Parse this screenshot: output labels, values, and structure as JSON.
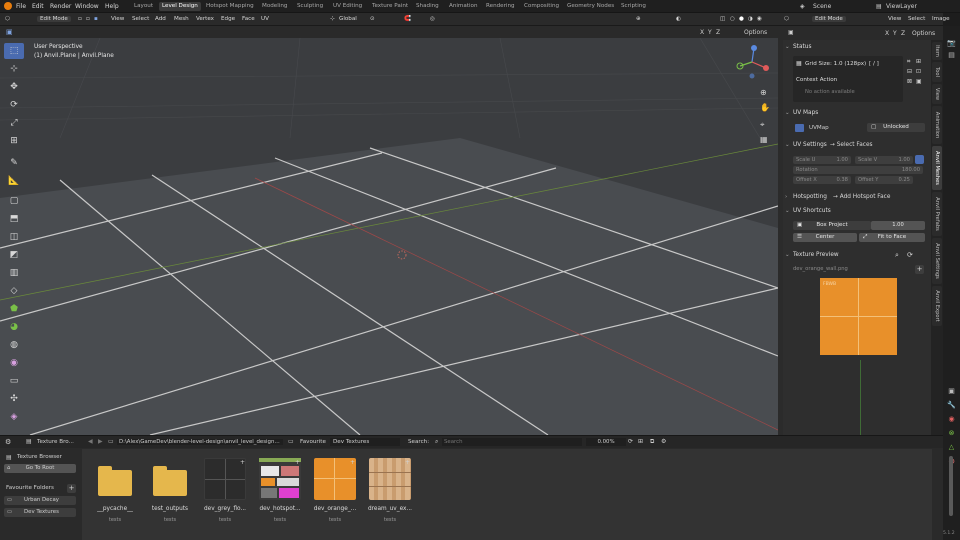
{
  "menu": [
    "File",
    "Edit",
    "Render",
    "Window",
    "Help"
  ],
  "workspaces": [
    "Layout",
    "Level Design",
    "Hotspot Mapping",
    "Modeling",
    "Sculpting",
    "UV Editing",
    "Texture Paint",
    "Shading",
    "Animation",
    "Rendering",
    "Compositing",
    "Geometry Nodes",
    "Scripting"
  ],
  "active_workspace": "Level Design",
  "scene": {
    "label": "Scene",
    "view_layer": "ViewLayer"
  },
  "viewport_header": {
    "mode": "Edit Mode",
    "menus": [
      "View",
      "Select",
      "Add",
      "Mesh",
      "Vertex",
      "Edge",
      "Face",
      "UV"
    ],
    "transform": "Global",
    "axes": [
      "X",
      "Y",
      "Z"
    ],
    "options": "Options"
  },
  "viewport": {
    "line1": "User Perspective",
    "line2": "(1) Anvil.Plane | Anvil.Plane"
  },
  "uv_header": {
    "mode": "Edit Mode",
    "menus": [
      "View",
      "Select",
      "Image"
    ],
    "axes": [
      "X",
      "Y",
      "Z"
    ],
    "options": "Options"
  },
  "npanel": {
    "status_title": "Status",
    "grid_size": "Grid Size: 1.0 (128px)",
    "grid_mark": "[ / ]",
    "context_action": "Context Action",
    "no_action": "No action available",
    "uv_maps_title": "UV Maps",
    "uvmap": "UVMap",
    "unlocked": "Unlocked",
    "uv_settings_title": "UV Settings",
    "uv_settings_sub": "→ Select Faces",
    "scale_u_label": "Scale U",
    "scale_u": "1.00",
    "scale_v_label": "Scale V",
    "scale_v": "1.00",
    "rotation_label": "Rotation",
    "rotation": "180.00",
    "offset_x_label": "Offset X",
    "offset_x": "0.38",
    "offset_y_label": "Offset Y",
    "offset_y": "0.25",
    "hotspotting_title": "Hotspotting",
    "hotspotting_sub": "→ Add Hotspot Face",
    "uv_shortcuts_title": "UV Shortcuts",
    "box_project": "Box Project",
    "box_value": "1.00",
    "center": "Center",
    "fit_to_face": "Fit to Face",
    "texture_preview_title": "Texture Preview",
    "texture_name": "dev_orange_wall.png",
    "texture_label": "FBWB"
  },
  "side_tabs": [
    "Item",
    "Tool",
    "View",
    "Animation",
    "Anvil Meshes",
    "Anvil Prefabs",
    "Anvil Settings",
    "Anvil Export"
  ],
  "active_side_tab": "Anvil Meshes",
  "browser_header": {
    "editor": "Texture Bro...",
    "path": "D:\\Alex\\GameDev\\blender-level-design\\anvil_level_design\\...",
    "favourite_label": "Favourite",
    "favourite_value": "Dev Textures",
    "search_label": "Search:",
    "search_placeholder": "Search",
    "zoom": "0.00%"
  },
  "browser_side": {
    "title": "Texture Browser",
    "go_to_root": "Go To Root",
    "favourites_title": "Favourite Folders",
    "folders": [
      "Urban Decay",
      "Dev Textures"
    ]
  },
  "assets": [
    {
      "name": "__pycache__",
      "sub": "tests",
      "kind": "folder"
    },
    {
      "name": "test_outputs",
      "sub": "tests",
      "kind": "folder"
    },
    {
      "name": "dev_grey_flo...",
      "sub": "tests",
      "kind": "grey"
    },
    {
      "name": "dev_hotspot...",
      "sub": "tests",
      "kind": "hotspot"
    },
    {
      "name": "dev_orange_...",
      "sub": "tests",
      "kind": "orange"
    },
    {
      "name": "dream_uv_ex...",
      "sub": "tests",
      "kind": "wood"
    }
  ],
  "version": "5.1.2",
  "colors": {
    "accent": "#4a6bb0",
    "orange": "#e8902a",
    "folder": "#e5b74c",
    "viewport": "#3b3d40"
  }
}
